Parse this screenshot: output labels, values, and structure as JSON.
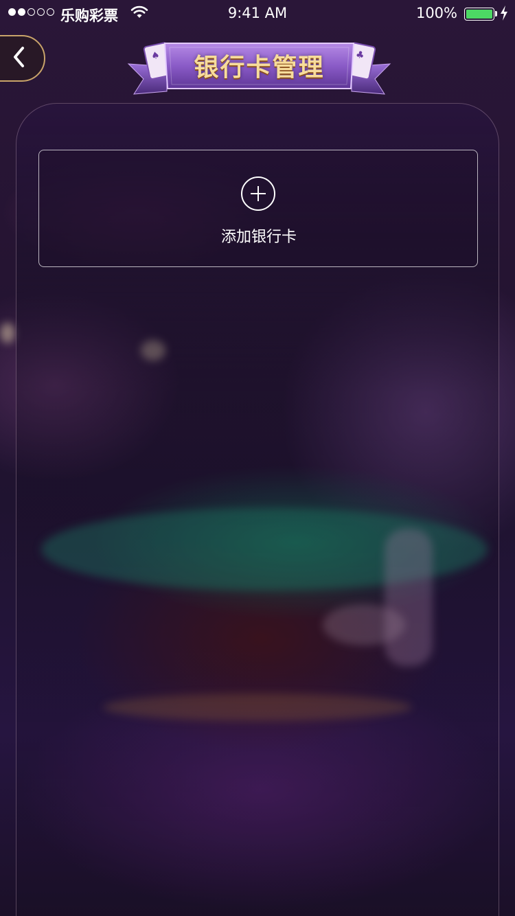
{
  "status_bar": {
    "carrier": "乐购彩票",
    "time": "9:41 AM",
    "battery": "100%",
    "battery_level": 1.0,
    "signal_bars_on": 2,
    "signal_bars_total": 5
  },
  "header": {
    "title": "银行卡管理",
    "back_icon": "chevron-left-icon"
  },
  "add_card": {
    "label": "添加银行卡",
    "icon": "plus-circle-icon"
  },
  "colors": {
    "accent_gold": "#c9a46a",
    "title_text": "#f7dc9b",
    "banner_purple": "#8a5bc7",
    "battery_green": "#4cd964"
  }
}
